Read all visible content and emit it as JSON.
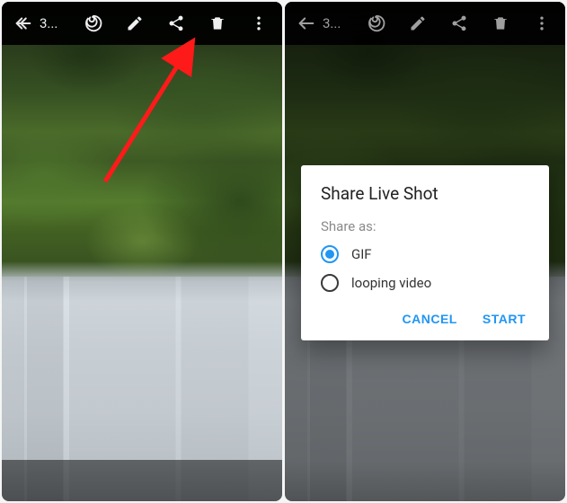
{
  "toolbar": {
    "counter": "3...",
    "icons": {
      "back": "back-arrow-icon",
      "spiral": "spiral-icon",
      "edit": "pencil-icon",
      "share": "share-icon",
      "delete": "trash-icon",
      "more": "more-vert-icon"
    }
  },
  "dialog": {
    "title": "Share Live Shot",
    "subtitle": "Share as:",
    "options": {
      "gif": "GIF",
      "looping": "looping video"
    },
    "selected": "gif",
    "cancel": "CANCEL",
    "start": "START"
  },
  "annotation": {
    "arrow_color": "#ff1a1a"
  }
}
